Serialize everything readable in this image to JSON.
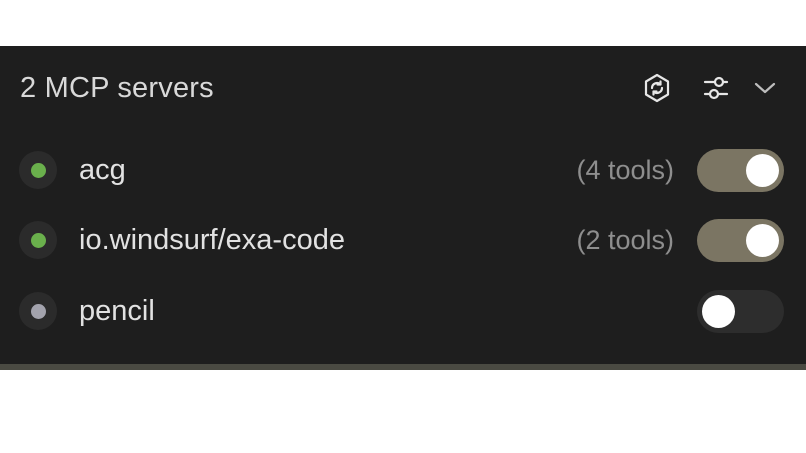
{
  "header": {
    "title": "2 MCP servers",
    "icons": [
      "mcp-refresh-icon",
      "sliders-icon",
      "chevron-down-icon"
    ]
  },
  "colors": {
    "panel_bg": "#1e1e1e",
    "status_on": "#6ab04c",
    "status_off": "#a3a3ad",
    "toggle_on": "#7b7563",
    "toggle_off": "#2d2d2d"
  },
  "servers": [
    {
      "name": "acg",
      "tools": "(4 tools)",
      "enabled": true
    },
    {
      "name": "io.windsurf/exa-code",
      "tools": "(2 tools)",
      "enabled": true
    },
    {
      "name": "pencil",
      "tools": "",
      "enabled": false
    }
  ]
}
